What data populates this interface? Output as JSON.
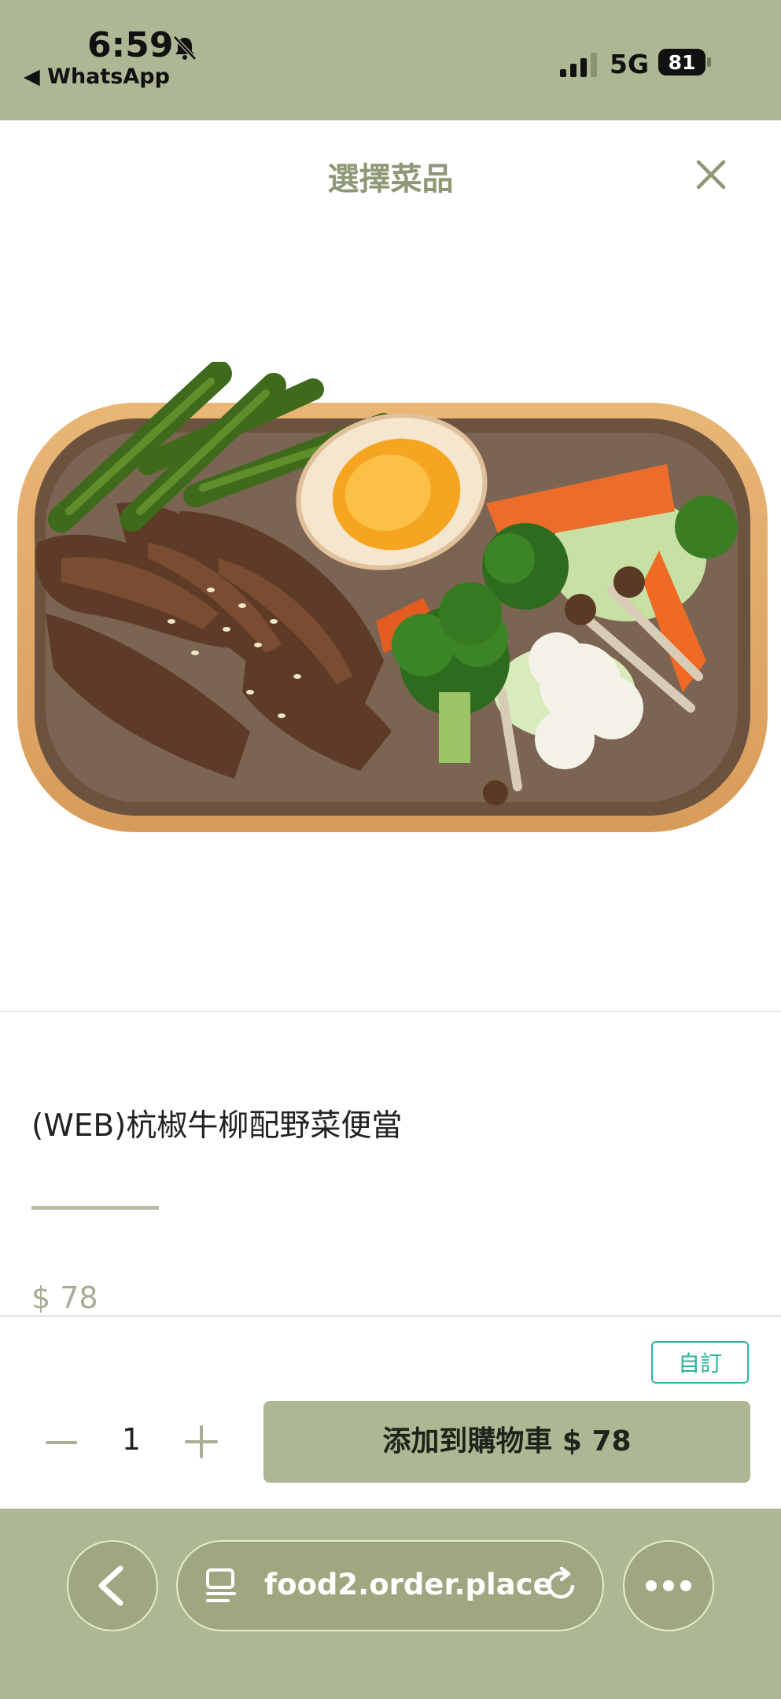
{
  "status_bar": {
    "time": "6:59",
    "back_app": "◀ WhatsApp",
    "network": "5G",
    "battery": "81"
  },
  "header": {
    "title": "選擇菜品"
  },
  "product": {
    "name": "(WEB)杭椒牛柳配野菜便當",
    "price": "$ 78"
  },
  "order": {
    "custom_label": "自訂",
    "quantity": "1",
    "add_to_cart_label": "添加到購物車 $ 78"
  },
  "browser": {
    "url": "food2.order.place"
  },
  "colors": {
    "brand": "#aeb793",
    "accent_teal": "#2bb39a",
    "title": "#8e9876"
  }
}
